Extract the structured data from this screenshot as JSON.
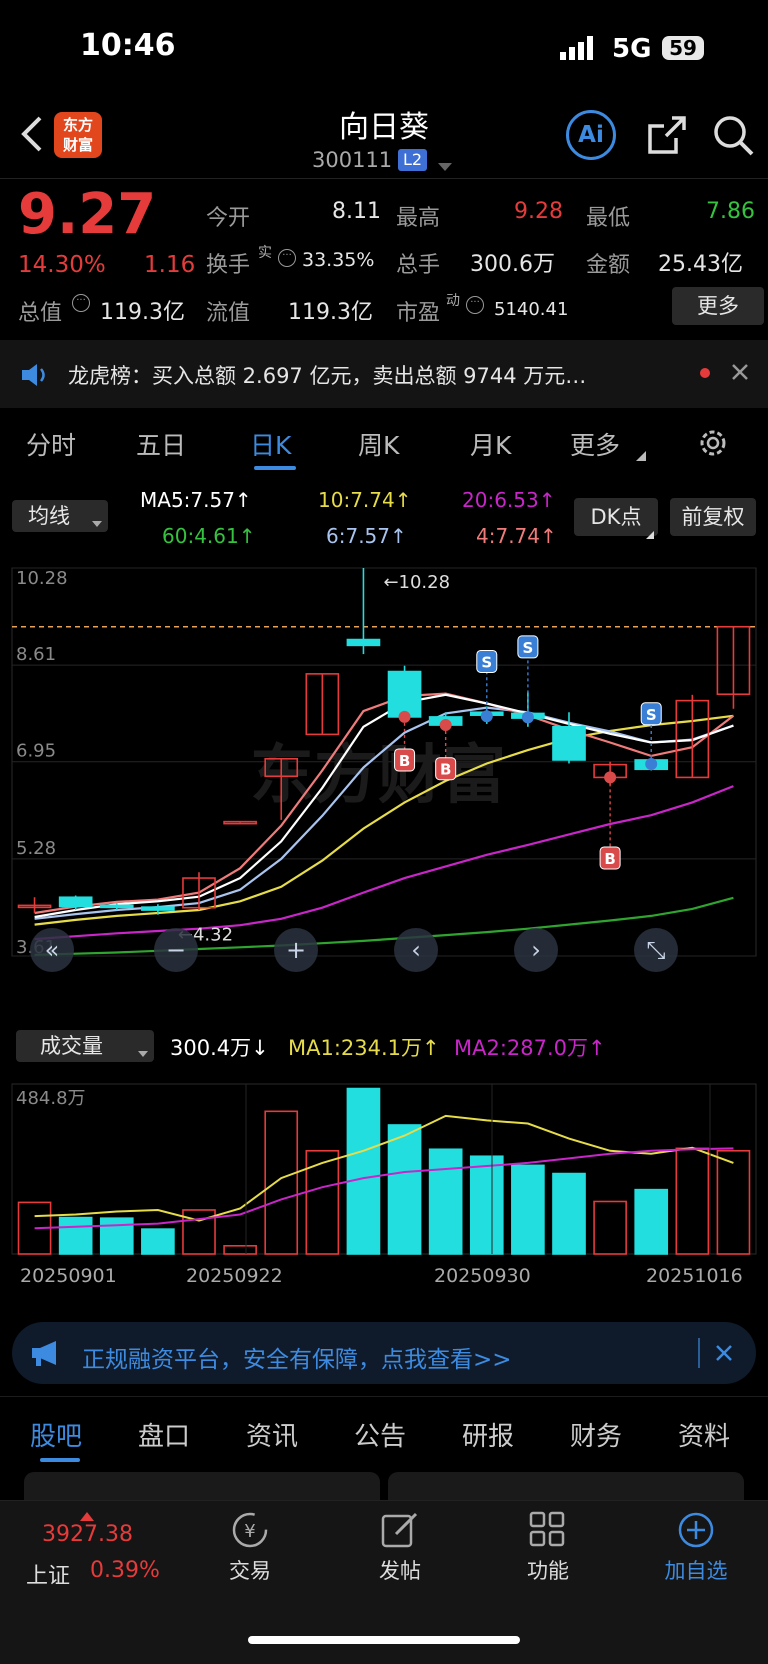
{
  "status_bar": {
    "time": "10:46",
    "network": "5G",
    "battery": "59"
  },
  "header": {
    "title": "向日葵",
    "code": "300111",
    "level_badge": "L2"
  },
  "quote": {
    "price": "9.27",
    "change_pct": "14.30%",
    "change": "1.16",
    "open_label": "今开",
    "open": "8.11",
    "high_label": "最高",
    "high": "9.28",
    "low_label": "最低",
    "low": "7.86",
    "turnover_label": "换手",
    "turnover_sup": "实",
    "turnover": "33.35%",
    "volume_label": "总手",
    "volume": "300.6万",
    "amount_label": "金额",
    "amount": "25.43亿",
    "mktcap_label": "总值",
    "mktcap": "119.3亿",
    "float_label": "流值",
    "float": "119.3亿",
    "pe_label": "市盈",
    "pe_sup": "动",
    "pe": "5140.41",
    "more_label": "更多"
  },
  "ticker": {
    "text": "龙虎榜：买入总额 2.697 亿元，卖出总额 9744 万元…"
  },
  "chart_tabs": [
    "分时",
    "五日",
    "日K",
    "周K",
    "月K",
    "更多"
  ],
  "ma_controls": {
    "select": "均线",
    "dk_button": "DK点",
    "adjust_button": "前复权",
    "ma5": "MA5:7.57↑",
    "ma10": "10:7.74↑",
    "ma20": "20:6.53↑",
    "ma60": "60:4.61↑",
    "ma6": "6:7.57↑",
    "ma4": "4:7.74↑"
  },
  "colors": {
    "up": "#e53b3b",
    "down": "#22dede",
    "ma5": "#ffffff",
    "ma10": "#e6dc4a",
    "ma20": "#c826c8",
    "ma60": "#2fa52f",
    "ma6": "#a8c4ef",
    "ma4": "#f07b7b",
    "accent": "#3d8be0"
  },
  "chart_data": {
    "type": "candlestick",
    "y_ticks": [
      "10.28",
      "8.61",
      "6.95",
      "5.28",
      "3.61"
    ],
    "ylim": [
      3.61,
      10.28
    ],
    "max_label": "10.28",
    "min_label": "4.32",
    "candles": [
      {
        "o": 4.48,
        "c": 4.48,
        "h": 4.62,
        "l": 4.35
      },
      {
        "o": 4.62,
        "c": 4.46,
        "h": 4.65,
        "l": 4.4
      },
      {
        "o": 4.48,
        "c": 4.45,
        "h": 4.52,
        "l": 4.4
      },
      {
        "o": 4.45,
        "c": 4.4,
        "h": 4.5,
        "l": 4.32
      },
      {
        "o": 4.44,
        "c": 4.95,
        "h": 5.05,
        "l": 4.4
      },
      {
        "o": 5.9,
        "c": 5.92,
        "h": 5.92,
        "l": 5.9
      },
      {
        "o": 6.7,
        "c": 7.0,
        "h": 7.0,
        "l": 5.95
      },
      {
        "o": 7.42,
        "c": 8.46,
        "h": 8.46,
        "l": 7.42
      },
      {
        "o": 9.05,
        "c": 8.95,
        "h": 10.28,
        "l": 8.8
      },
      {
        "o": 8.5,
        "c": 7.72,
        "h": 8.6,
        "l": 7.65
      },
      {
        "o": 7.72,
        "c": 7.58,
        "h": 7.8,
        "l": 7.5
      },
      {
        "o": 7.8,
        "c": 7.75,
        "h": 7.9,
        "l": 7.6
      },
      {
        "o": 7.78,
        "c": 7.7,
        "h": 8.15,
        "l": 7.55
      },
      {
        "o": 7.55,
        "c": 6.98,
        "h": 7.8,
        "l": 6.92
      },
      {
        "o": 6.68,
        "c": 6.9,
        "h": 6.95,
        "l": 6.55
      },
      {
        "o": 6.98,
        "c": 6.82,
        "h": 7.0,
        "l": 6.8
      },
      {
        "o": 6.68,
        "c": 8.0,
        "h": 8.1,
        "l": 6.68
      },
      {
        "o": 8.11,
        "c": 9.27,
        "h": 9.28,
        "l": 7.86
      }
    ],
    "ma5_line": [
      4.28,
      4.4,
      4.5,
      4.55,
      4.63,
      4.95,
      5.58,
      6.5,
      7.55,
      7.97,
      8.1,
      7.95,
      7.78,
      7.6,
      7.43,
      7.28,
      7.32,
      7.57
    ],
    "ma10_line": [
      4.15,
      4.23,
      4.3,
      4.35,
      4.4,
      4.55,
      4.8,
      5.25,
      5.8,
      6.25,
      6.62,
      6.92,
      7.15,
      7.35,
      7.48,
      7.58,
      7.65,
      7.74
    ],
    "ma20_line": [
      3.9,
      3.95,
      4.0,
      4.04,
      4.08,
      4.14,
      4.25,
      4.44,
      4.7,
      4.95,
      5.15,
      5.35,
      5.52,
      5.7,
      5.88,
      6.03,
      6.25,
      6.53
    ],
    "ma60_line": [
      3.63,
      3.65,
      3.67,
      3.7,
      3.73,
      3.76,
      3.79,
      3.83,
      3.87,
      3.92,
      3.97,
      4.02,
      4.08,
      4.15,
      4.22,
      4.3,
      4.42,
      4.61
    ],
    "ma6_line": [
      4.25,
      4.33,
      4.4,
      4.45,
      4.52,
      4.75,
      5.28,
      6.02,
      6.85,
      7.45,
      7.78,
      7.88,
      7.8,
      7.62,
      7.47,
      7.28,
      7.33,
      7.57
    ],
    "ma4_line": [
      4.35,
      4.46,
      4.54,
      4.58,
      4.7,
      5.12,
      5.85,
      6.8,
      7.82,
      8.08,
      8.12,
      7.95,
      7.75,
      7.5,
      7.28,
      7.05,
      7.2,
      7.74
    ],
    "buy_marks": [
      9,
      10,
      14
    ],
    "sell_marks": [
      11,
      12,
      15
    ],
    "volume": {
      "select": "成交量",
      "current": "300.4万↓",
      "ma1": "MA1:234.1万↑",
      "ma2": "MA2:287.0万↑",
      "ymax_label": "484.8万",
      "values": [
        170,
        120,
        118,
        82,
        145,
        27,
        470,
        340,
        545,
        425,
        345,
        322,
        292,
        265,
        173,
        212,
        348,
        340
      ],
      "ma1_line": [
        125,
        130,
        140,
        145,
        110,
        150,
        250,
        300,
        340,
        390,
        455,
        440,
        430,
        380,
        340,
        330,
        350,
        300
      ],
      "ma2_line": [
        85,
        90,
        95,
        100,
        115,
        130,
        180,
        220,
        250,
        270,
        280,
        290,
        300,
        315,
        330,
        340,
        345,
        348
      ],
      "date_labels": [
        "20250901",
        "20250922",
        "20250930",
        "20251016"
      ]
    }
  },
  "nav_buttons": [
    "«",
    "−",
    "+",
    "‹",
    "›",
    "⤡"
  ],
  "promo": {
    "text": "正规融资平台，安全有保障，点我查看>>"
  },
  "bottom_tabs": [
    "股吧",
    "盘口",
    "资讯",
    "公告",
    "研报",
    "财务",
    "资料"
  ],
  "dock": {
    "index_value": "3927.38",
    "index_name": "上证",
    "index_change": "0.39%",
    "items": [
      "交易",
      "发帖",
      "功能",
      "加自选"
    ]
  }
}
